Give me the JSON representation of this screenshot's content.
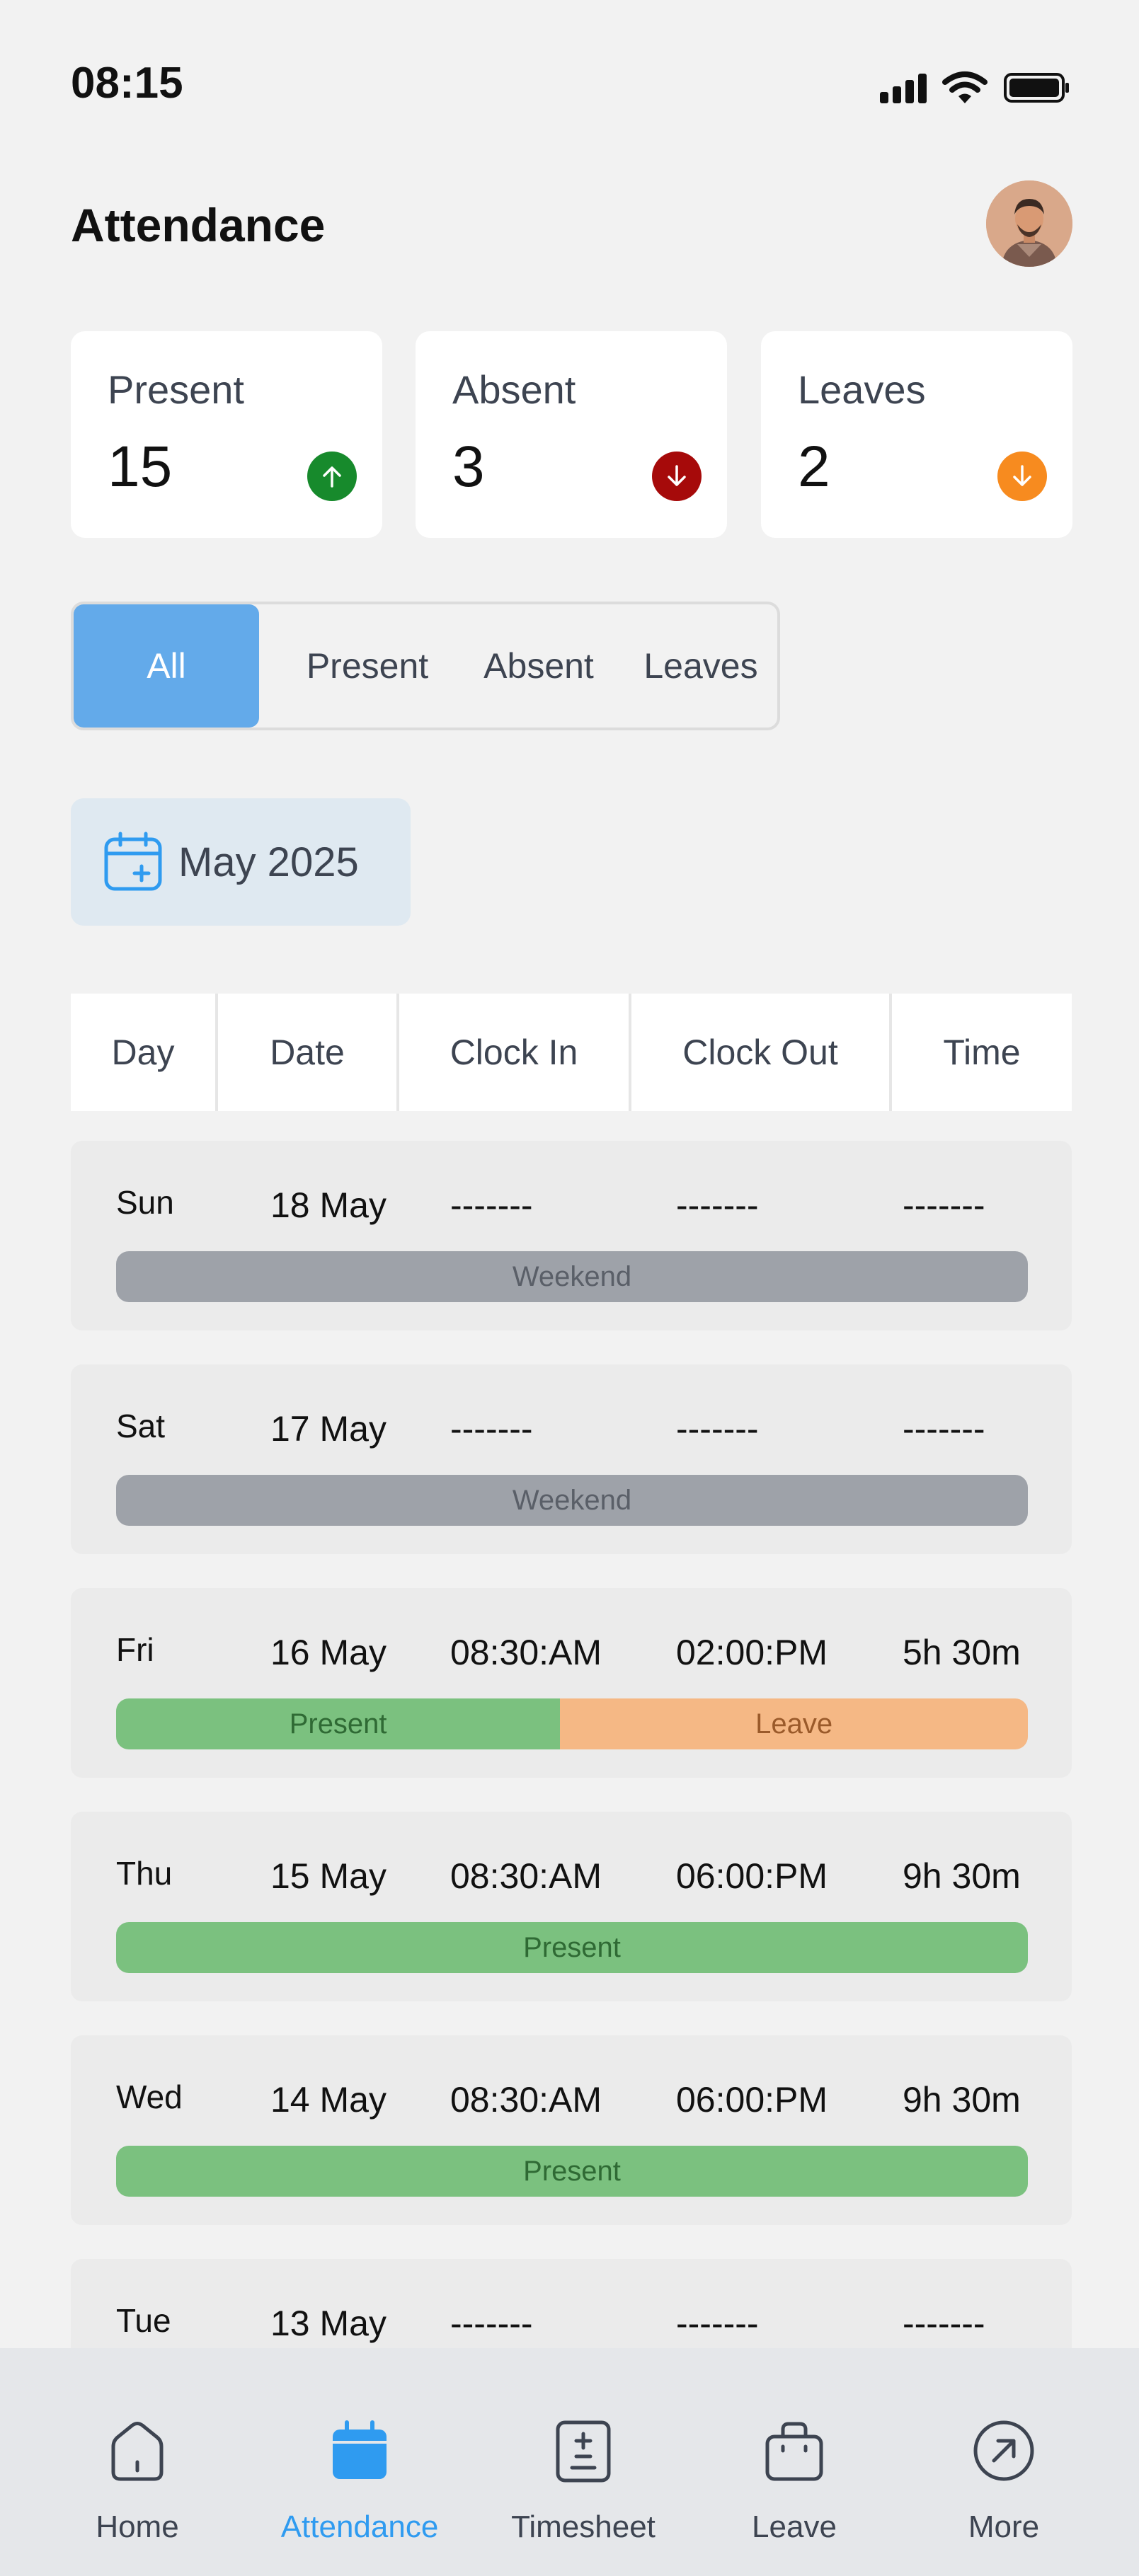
{
  "status_bar": {
    "time": "08:15"
  },
  "header": {
    "title": "Attendance"
  },
  "stats": [
    {
      "label": "Present",
      "value": "15",
      "color": "#178a2c",
      "direction": "up"
    },
    {
      "label": "Absent",
      "value": "3",
      "color": "#a60a0a",
      "direction": "down"
    },
    {
      "label": "Leaves",
      "value": "2",
      "color": "#f78b1f",
      "direction": "down"
    }
  ],
  "filters": {
    "tabs": [
      "All",
      "Present",
      "Absent",
      "Leaves"
    ],
    "active": "All"
  },
  "month_picker": {
    "label": "May 2025"
  },
  "table": {
    "columns": [
      "Day",
      "Date",
      "Clock In",
      "Clock Out",
      "Time"
    ],
    "rows": [
      {
        "day": "Sun",
        "date": "18 May",
        "clock_in": "-------",
        "clock_out": "-------",
        "time": "-------",
        "bar": [
          {
            "label": "Weekend",
            "fraction": 1.0,
            "color": "#9ea2a9",
            "text_color": "#5a5f68"
          }
        ]
      },
      {
        "day": "Sat",
        "date": "17 May",
        "clock_in": "-------",
        "clock_out": "-------",
        "time": "-------",
        "bar": [
          {
            "label": "Weekend",
            "fraction": 1.0,
            "color": "#9ea2a9",
            "text_color": "#5a5f68"
          }
        ]
      },
      {
        "day": "Fri",
        "date": "16 May",
        "clock_in": "08:30:AM",
        "clock_out": "02:00:PM",
        "time": "5h 30m",
        "bar": [
          {
            "label": "Present",
            "fraction": 0.487,
            "color": "#7bc17f",
            "text_color": "#2f6a34"
          },
          {
            "label": "Leave",
            "fraction": 0.513,
            "color": "#f5b885",
            "text_color": "#9a5a2a"
          }
        ]
      },
      {
        "day": "Thu",
        "date": "15 May",
        "clock_in": "08:30:AM",
        "clock_out": "06:00:PM",
        "time": "9h 30m",
        "bar": [
          {
            "label": "Present",
            "fraction": 1.0,
            "color": "#7bc17f",
            "text_color": "#2f6a34"
          }
        ]
      },
      {
        "day": "Wed",
        "date": "14 May",
        "clock_in": "08:30:AM",
        "clock_out": "06:00:PM",
        "time": "9h 30m",
        "bar": [
          {
            "label": "Present",
            "fraction": 1.0,
            "color": "#7bc17f",
            "text_color": "#2f6a34"
          }
        ]
      },
      {
        "day": "Tue",
        "date": "13 May",
        "clock_in": "-------",
        "clock_out": "-------",
        "time": "-------",
        "bar": []
      }
    ]
  },
  "bottom_nav": {
    "items": [
      {
        "label": "Home",
        "icon": "home-icon"
      },
      {
        "label": "Attendance",
        "icon": "calendar-icon"
      },
      {
        "label": "Timesheet",
        "icon": "timesheet-icon"
      },
      {
        "label": "Leave",
        "icon": "briefcase-icon"
      },
      {
        "label": "More",
        "icon": "arrow-up-right-icon"
      }
    ],
    "active": "Attendance"
  }
}
